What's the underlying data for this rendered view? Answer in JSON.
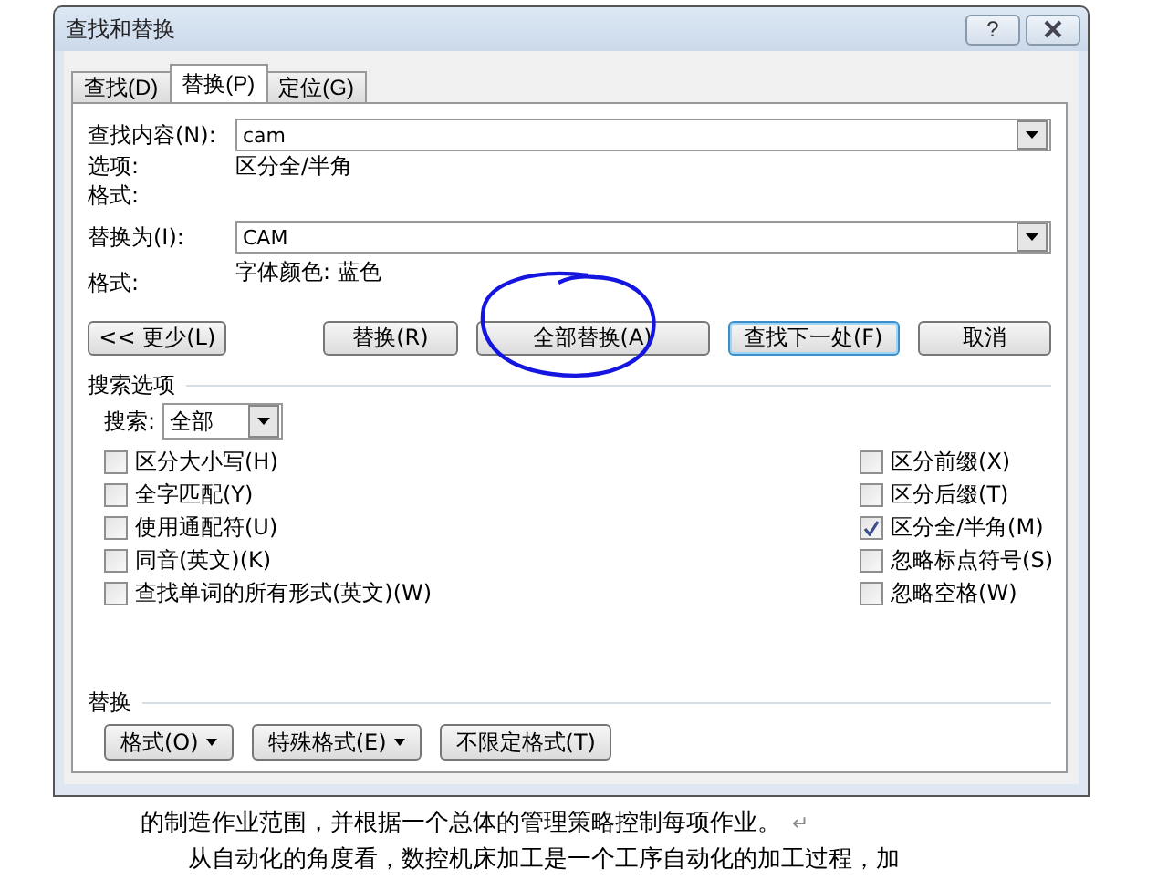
{
  "window": {
    "title": "查找和替换",
    "help": "?"
  },
  "tabs": [
    {
      "label": "查找(D)",
      "selected": false
    },
    {
      "label": "替换(P)",
      "selected": true
    },
    {
      "label": "定位(G)",
      "selected": false
    }
  ],
  "find": {
    "label": "查找内容(N):",
    "value": "cam",
    "options_label": "选项:",
    "options_value": "区分全/半角",
    "format_label": "格式:"
  },
  "replace": {
    "label": "替换为(I):",
    "value": "CAM",
    "format_label": "格式:",
    "format_value": "字体颜色: 蓝色"
  },
  "buttons": [
    {
      "label": "<< 更少(L)",
      "default": false
    },
    {
      "label": "替换(R)",
      "default": false
    },
    {
      "label": "全部替换(A)",
      "default": false
    },
    {
      "label": "查找下一处(F)",
      "default": true
    },
    {
      "label": "取消",
      "default": false
    }
  ],
  "search_options": {
    "heading": "搜索选项",
    "search_label": "搜索:",
    "search_value": "全部",
    "left": [
      {
        "label": "区分大小写(H)",
        "checked": false
      },
      {
        "label": "全字匹配(Y)",
        "checked": false
      },
      {
        "label": "使用通配符(U)",
        "checked": false
      },
      {
        "label": "同音(英文)(K)",
        "checked": false
      },
      {
        "label": "查找单词的所有形式(英文)(W)",
        "checked": false
      }
    ],
    "right": [
      {
        "label": "区分前缀(X)",
        "checked": false
      },
      {
        "label": "区分后缀(T)",
        "checked": false
      },
      {
        "label": "区分全/半角(M)",
        "checked": true
      },
      {
        "label": "忽略标点符号(S)",
        "checked": false
      },
      {
        "label": "忽略空格(W)",
        "checked": false
      }
    ]
  },
  "replace_section": {
    "heading": "替换",
    "buttons": [
      {
        "label": "格式(O)",
        "dropdown": true
      },
      {
        "label": "特殊格式(E)",
        "dropdown": true
      },
      {
        "label": "不限定格式(T)",
        "dropdown": false
      }
    ]
  },
  "document": {
    "lines": [
      {
        "text": "的制造作业范围，并根据一个总体的管理策略控制每项作业。",
        "mark": "↵"
      },
      {
        "text": "　　从自动化的角度看，数控机床加工是一个工序自动化的加工过程，加"
      }
    ]
  }
}
